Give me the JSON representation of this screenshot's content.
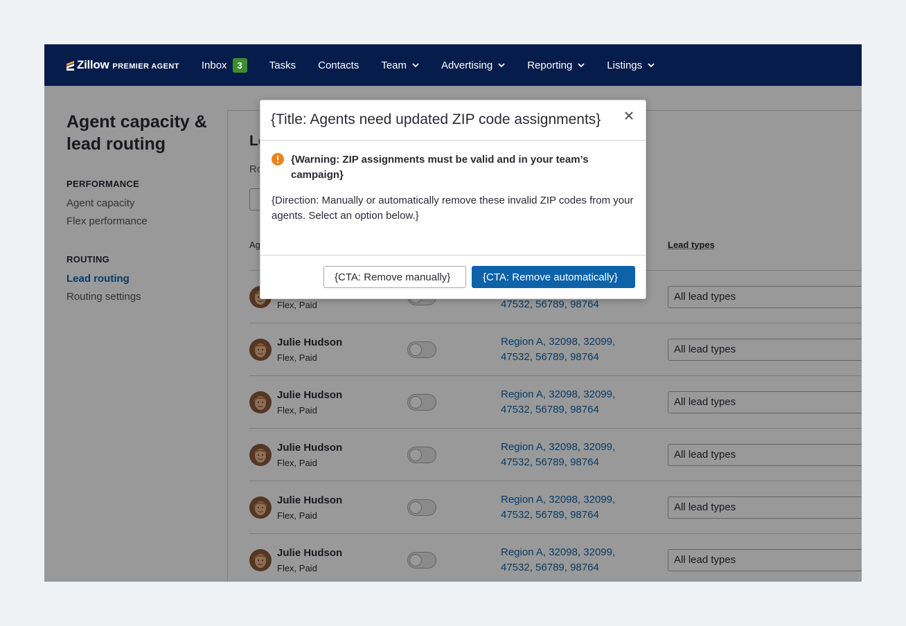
{
  "brand": {
    "logo_text": "Zillow",
    "logo_sub": "PREMIER AGENT"
  },
  "nav": {
    "items": [
      {
        "label": "Inbox",
        "badge": "3"
      },
      {
        "label": "Tasks"
      },
      {
        "label": "Contacts"
      },
      {
        "label": "Team"
      },
      {
        "label": "Advertising"
      },
      {
        "label": "Reporting"
      },
      {
        "label": "Listings"
      }
    ]
  },
  "sidebar": {
    "title": "Agent capacity & lead routing",
    "sections": [
      {
        "heading": "PERFORMANCE",
        "links": [
          "Agent capacity",
          "Flex performance"
        ]
      },
      {
        "heading": "ROUTING",
        "links": [
          "Lead routing",
          "Routing settings"
        ],
        "active": "Lead routing"
      }
    ]
  },
  "main": {
    "heading_partial": "Le",
    "sub_partial": "Ro",
    "col_agent_partial": "Ag",
    "col_lead_types": "Lead types",
    "rows": [
      {
        "name": "Julie Hudson",
        "type": "Flex, Paid",
        "zips": "Region A, 32098, 32099, 47532, 56789, 98764",
        "lead_types": "All lead types"
      },
      {
        "name": "Julie Hudson",
        "type": "Flex, Paid",
        "zips": "Region A, 32098, 32099, 47532, 56789, 98764",
        "lead_types": "All lead types"
      },
      {
        "name": "Julie Hudson",
        "type": "Flex, Paid",
        "zips": "Region A, 32098, 32099, 47532, 56789, 98764",
        "lead_types": "All lead types"
      },
      {
        "name": "Julie Hudson",
        "type": "Flex, Paid",
        "zips": "Region A, 32098, 32099, 47532, 56789, 98764",
        "lead_types": "All lead types"
      },
      {
        "name": "Julie Hudson",
        "type": "Flex, Paid",
        "zips": "Region A, 32098, 32099, 47532, 56789, 98764",
        "lead_types": "All lead types"
      },
      {
        "name": "Julie Hudson",
        "type": "Flex, Paid",
        "zips": "Region A, 32098, 32099, 47532, 56789, 98764",
        "lead_types": "All lead types"
      }
    ]
  },
  "modal": {
    "title": "{Title: Agents need updated ZIP code assignments}",
    "warning": "{Warning: ZIP assignments must be valid and in your team’s campaign}",
    "direction": "{Direction: Manually or automatically remove these invalid ZIP codes from your agents. Select an option below.}",
    "secondary_cta": "{CTA: Remove manually}",
    "primary_cta": "{CTA: Remove automatically}"
  },
  "colors": {
    "nav_bg": "#061c4b",
    "badge": "#3d8f2e",
    "link": "#0e62a8",
    "primary": "#0e62a8",
    "warning": "#e8831d",
    "page_bg": "#eff2f5"
  },
  "icons": {
    "close": "close-icon",
    "warning": "warning-icon",
    "chevron": "chevron-down-icon",
    "logo": "zillow-logo-icon",
    "avatar": "avatar"
  }
}
